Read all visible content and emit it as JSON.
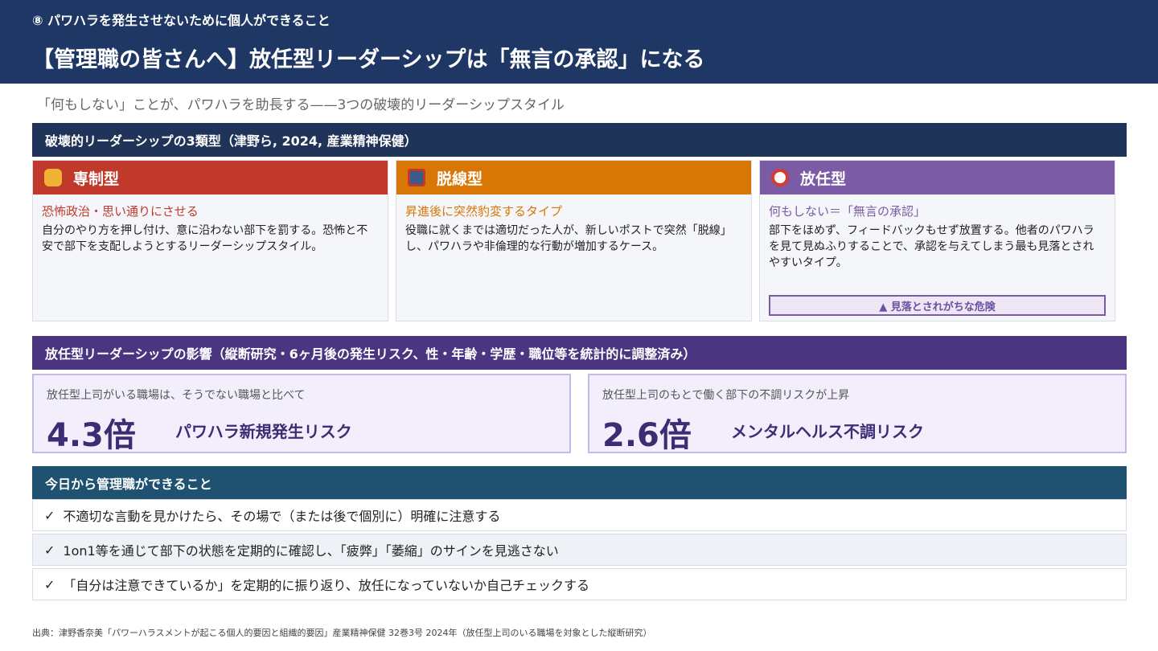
{
  "header": {
    "kicker": "⑧ パワハラを発生させないために個人ができること",
    "title": "【管理職の皆さんへ】放任型リーダーシップは「無言の承認」になる"
  },
  "subtitle": "「何もしない」ことが、パワハラを助長する——3つの破壊的リーダーシップスタイル",
  "types_section": {
    "heading": "破壊的リーダーシップの3類型（津野ら, 2024, 産業精神保健）",
    "cards": [
      {
        "name": "専制型",
        "icon": "fist-icon",
        "color": "#c0392b",
        "tag": "恐怖政治・思い通りにさせる",
        "desc": "自分のやり方を押し付け、意に沿わない部下を罰する。恐怖と不安で部下を支配しようとするリーダーシップスタイル。"
      },
      {
        "name": "脱線型",
        "icon": "train-icon",
        "color": "#d97706",
        "tag": "昇進後に突然豹変するタイプ",
        "desc": "役職に就くまでは適切だった人が、新しいポストで突然「脱線」し、パワハラや非倫理的な行動が増加するケース。"
      },
      {
        "name": "放任型",
        "icon": "prohibited-icon",
        "color": "#7b5aa6",
        "tag": "何もしない＝「無言の承認」",
        "desc": "部下をほめず、フィードバックもせず放置する。他者のパワハラを見て見ぬふりすることで、承認を与えてしまう最も見落とされやすいタイプ。",
        "warning": "▲ 見落とされがちな危険"
      }
    ]
  },
  "impact": {
    "heading": "放任型リーダーシップの影響（縦断研究・6ヶ月後の発生リスク、性・年齢・学歴・職位等を統計的に調整済み）",
    "stats": [
      {
        "lead": "放任型上司がいる職場は、そうでない職場と比べて",
        "value": "4.3倍",
        "label": "パワハラ新規発生リスク"
      },
      {
        "lead": "放任型上司のもとで働く部下の不調リスクが上昇",
        "value": "2.6倍",
        "label": "メンタルヘルス不調リスク"
      }
    ]
  },
  "actions": {
    "heading": "今日から管理職ができること",
    "check": "✓",
    "items": [
      "不適切な言動を見かけたら、その場で（または後で個別に）明確に注意する",
      "1on1等を通じて部下の状態を定期的に確認し、「疲弊」「萎縮」のサインを見逃さない",
      "「自分は注意できているか」を定期的に振り返り、放任になっていないか自己チェックする"
    ]
  },
  "citation": "出典：津野香奈美「パワーハラスメントが起こる個人的要因と組織的要因」産業精神保健 32巻3号 2024年（放任型上司のいる職場を対象とした縦断研究）"
}
